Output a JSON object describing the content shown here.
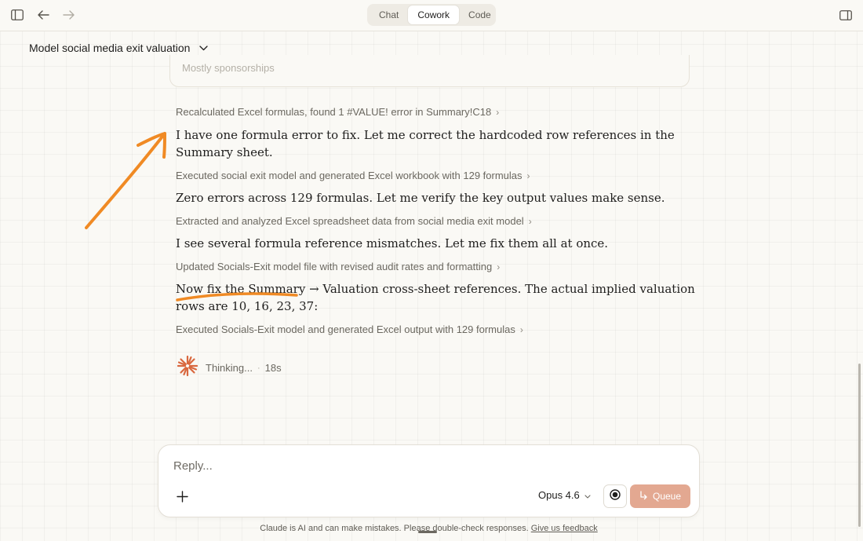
{
  "tabs": [
    "Chat",
    "Cowork",
    "Code"
  ],
  "active_tab": "Cowork",
  "conversation": {
    "title": "Model social media exit valuation",
    "previous_card_text": "Mostly sponsorships"
  },
  "steps": [
    "Recalculated Excel formulas, found 1 #VALUE! error in Summary!C18",
    "Executed social exit model and generated Excel workbook with 129 formulas",
    "Extracted and analyzed Excel spreadsheet data from social media exit model",
    "Updated Socials-Exit model file with revised audit rates and formatting",
    "Executed Socials-Exit model and generated Excel output with 129 formulas"
  ],
  "messages": [
    "I have one formula error to fix. Let me correct the hardcoded row references in the",
    "Summary sheet.",
    "Zero errors across 129 formulas. Let me verify the key output values make sense.",
    "I see several formula reference mismatches. Let me fix them all at once.",
    "Now fix the Summary → Valuation cross-sheet references. The actual implied valuation",
    "rows are 10, 16, 23, 37:"
  ],
  "thinking": {
    "label": "Thinking...",
    "separator": "·",
    "elapsed": "18s"
  },
  "composer": {
    "placeholder": "Reply...",
    "model": "Opus 4.6",
    "queue_label": "Queue"
  },
  "footer": {
    "disclaimer": "Claude is AI and can make mistakes. Please double-check responses.",
    "feedback_link": "Give us feedback"
  },
  "colors": {
    "background": "#faf9f5",
    "annotation": "#f08a24",
    "spark": "#d9683f",
    "queue_button": "#e3a891"
  },
  "icons": [
    "sidebar-toggle-icon",
    "back-arrow-icon",
    "forward-arrow-icon",
    "right-panel-icon",
    "chevron-down-icon",
    "chevron-right-icon",
    "plus-icon",
    "record-icon",
    "queue-return-icon",
    "claude-spark-icon"
  ]
}
